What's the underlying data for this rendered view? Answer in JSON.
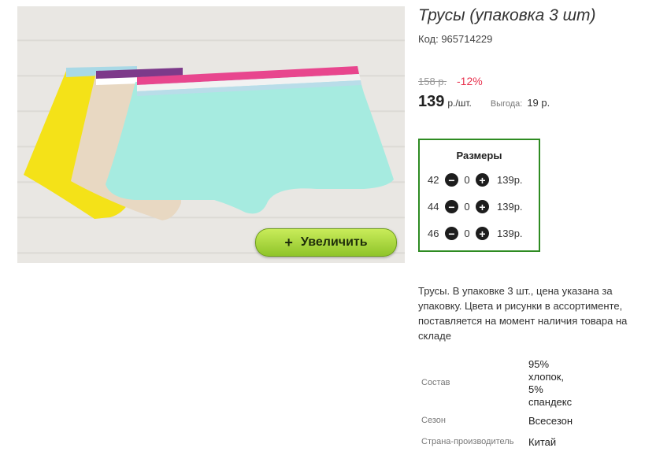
{
  "product": {
    "title": "Трусы (упаковка 3 шт)",
    "code": "Код: 965714229",
    "old_price": "158 р.",
    "discount": "-12%",
    "price": "139",
    "price_unit": "р./шт.",
    "benefit_label": "Выгода:",
    "benefit_value": "19 р."
  },
  "gallery": {
    "zoom_plus": "+",
    "zoom_label": "Увеличить"
  },
  "sizes": {
    "title": "Размеры",
    "minus_icon": "minus-circle-icon",
    "plus_icon": "plus-circle-icon",
    "rows": [
      {
        "size": "42",
        "qty": "0",
        "price": "139р."
      },
      {
        "size": "44",
        "qty": "0",
        "price": "139р."
      },
      {
        "size": "46",
        "qty": "0",
        "price": "139р."
      }
    ]
  },
  "description": "Трусы. В упаковке 3 шт., цена указана за упаковку. Цвета и рисунки в ассортименте, поставляется на момент наличия товара на складе",
  "specs": [
    {
      "label": "Состав",
      "value": [
        "95%",
        "хлопок,",
        "5%",
        "спандекс"
      ]
    },
    {
      "label": "Сезон",
      "value": [
        "Всесезон"
      ]
    },
    {
      "label": "Страна-производитель",
      "value": [
        "Китай"
      ]
    }
  ]
}
